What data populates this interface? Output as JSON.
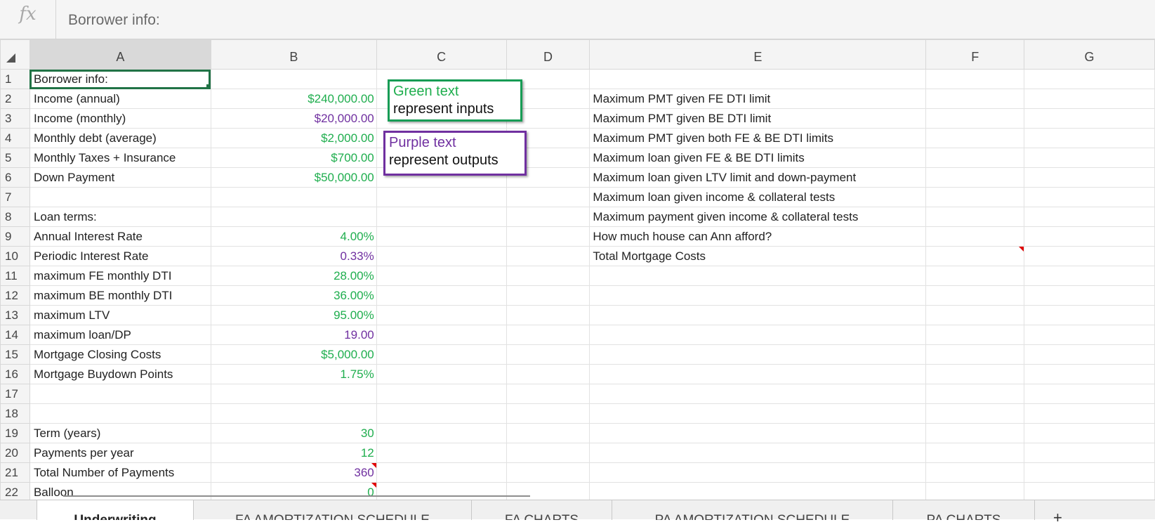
{
  "formula_bar": {
    "fx_label": "fx",
    "content": "Borrower info:"
  },
  "columns": [
    "A",
    "B",
    "C",
    "D",
    "E",
    "F",
    "G"
  ],
  "rows": [
    {
      "n": "1",
      "a": "Borrower info:",
      "b": "",
      "b_color": "",
      "e": "",
      "b_flag": false
    },
    {
      "n": "2",
      "a": "Income (annual)",
      "b": "$240,000.00",
      "b_color": "green",
      "e": "Maximum PMT given FE DTI limit",
      "b_flag": false
    },
    {
      "n": "3",
      "a": "Income (monthly)",
      "b": "$20,000.00",
      "b_color": "purple",
      "e": "Maximum PMT given BE DTI limit",
      "b_flag": false
    },
    {
      "n": "4",
      "a": "Monthly debt (average)",
      "b": "$2,000.00",
      "b_color": "green",
      "e": "Maximum PMT given both FE & BE DTI limits",
      "b_flag": false
    },
    {
      "n": "5",
      "a": "Monthly Taxes + Insurance",
      "b": "$700.00",
      "b_color": "green",
      "e": "Maximum loan given FE & BE DTI limits",
      "b_flag": false
    },
    {
      "n": "6",
      "a": "Down Payment",
      "b": "$50,000.00",
      "b_color": "green",
      "e": "Maximum loan given LTV limit and down-payment",
      "b_flag": false
    },
    {
      "n": "7",
      "a": "",
      "b": "",
      "b_color": "",
      "e": "Maximum loan given income & collateral tests",
      "b_flag": false
    },
    {
      "n": "8",
      "a": "Loan terms:",
      "b": "",
      "b_color": "",
      "e": "Maximum payment given income & collateral tests",
      "b_flag": false
    },
    {
      "n": "9",
      "a": "Annual Interest Rate",
      "b": "4.00%",
      "b_color": "green",
      "e": "How much house can Ann afford?",
      "b_flag": false
    },
    {
      "n": "10",
      "a": "Periodic Interest Rate",
      "b": "0.33%",
      "b_color": "purple",
      "e": "Total Mortgage Costs",
      "b_flag": false
    },
    {
      "n": "11",
      "a": "maximum FE monthly DTI",
      "b": "28.00%",
      "b_color": "green",
      "e": "",
      "b_flag": false
    },
    {
      "n": "12",
      "a": "maximum BE monthly DTI",
      "b": "36.00%",
      "b_color": "green",
      "e": "",
      "b_flag": false
    },
    {
      "n": "13",
      "a": "maximum LTV",
      "b": "95.00%",
      "b_color": "green",
      "e": "",
      "b_flag": false
    },
    {
      "n": "14",
      "a": "maximum loan/DP",
      "b": "19.00",
      "b_color": "purple",
      "e": "",
      "b_flag": false
    },
    {
      "n": "15",
      "a": "Mortgage Closing Costs",
      "b": "$5,000.00",
      "b_color": "green",
      "e": "",
      "b_flag": false
    },
    {
      "n": "16",
      "a": "Mortgage Buydown Points",
      "b": "1.75%",
      "b_color": "green",
      "e": "",
      "b_flag": false
    },
    {
      "n": "17",
      "a": "",
      "b": "",
      "b_color": "",
      "e": "",
      "b_flag": false
    },
    {
      "n": "18",
      "a": "",
      "b": "",
      "b_color": "",
      "e": "",
      "b_flag": false
    },
    {
      "n": "19",
      "a": "Term (years)",
      "b": "30",
      "b_color": "green",
      "e": "",
      "b_flag": false
    },
    {
      "n": "20",
      "a": "Payments per year",
      "b": "12",
      "b_color": "green",
      "e": "",
      "b_flag": false
    },
    {
      "n": "21",
      "a": "Total Number of Payments",
      "b": "360",
      "b_color": "purple",
      "e": "",
      "b_flag": true
    },
    {
      "n": "22",
      "a": "Balloon",
      "b": "0",
      "b_color": "green",
      "e": "",
      "b_flag": true
    }
  ],
  "legend": {
    "inputs": {
      "line1": "Green text",
      "line2": "represent inputs",
      "color": "#1fae4e"
    },
    "outputs": {
      "line1": "Purple text",
      "line2": "represent outputs",
      "color": "#7030a0"
    }
  },
  "sheet_tabs": [
    {
      "label": "Underwriting",
      "active": true
    },
    {
      "label": "FA AMORTIZATION SCHEDULE",
      "active": false
    },
    {
      "label": "FA CHARTS",
      "active": false
    },
    {
      "label": "PA AMORTIZATION SCHEDULE",
      "active": false
    },
    {
      "label": "PA CHARTS",
      "active": false
    }
  ],
  "add_sheet_label": "+"
}
